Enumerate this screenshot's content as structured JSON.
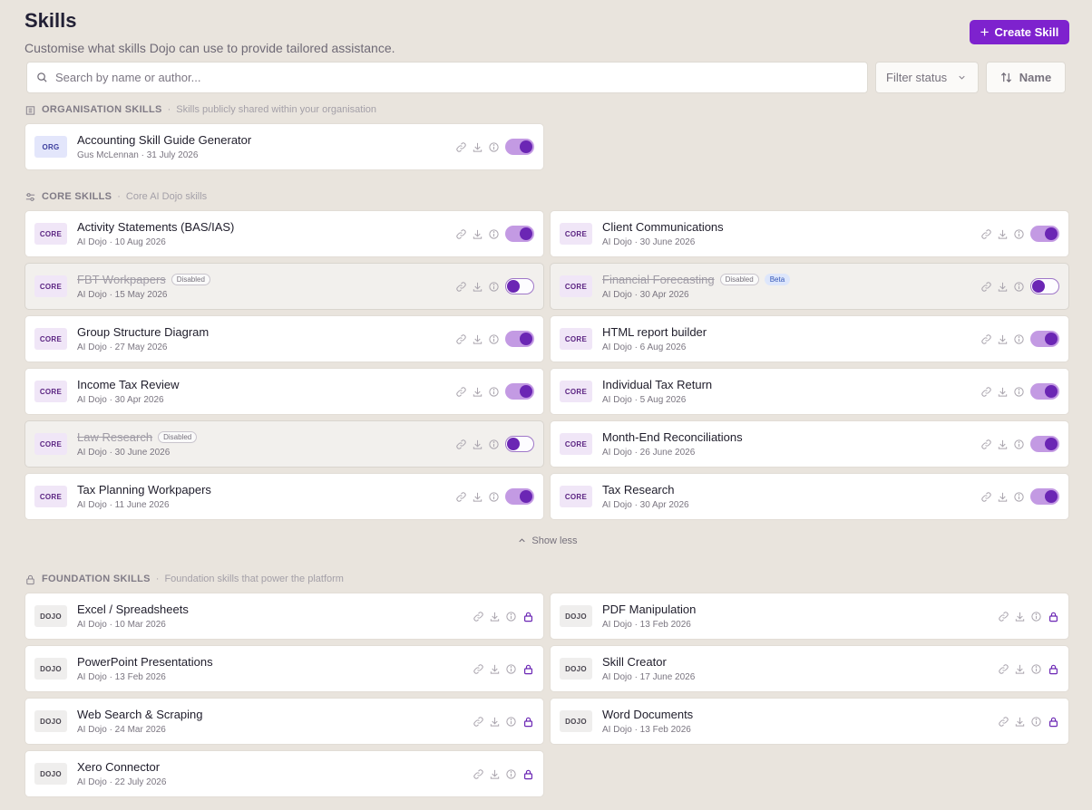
{
  "header": {
    "title": "Skills",
    "subtitle": "Customise what skills Dojo can use to provide tailored assistance.",
    "create_button": "Create Skill"
  },
  "toolbar": {
    "search_placeholder": "Search by name or author...",
    "filter_label": "Filter status",
    "sort_label": "Name"
  },
  "sections": {
    "org": {
      "title": "ORGANISATION SKILLS",
      "description": "Skills publicly shared within your organisation"
    },
    "core": {
      "title": "CORE SKILLS",
      "description": "Core AI Dojo skills"
    },
    "foundation": {
      "title": "FOUNDATION SKILLS",
      "description": "Foundation skills that power the platform"
    }
  },
  "show_less": "Show less",
  "badges": {
    "org": "ORG",
    "core": "CORE",
    "dojo": "DOJO"
  },
  "tags": {
    "disabled": "Disabled",
    "beta": "Beta"
  },
  "org_skills": [
    {
      "name": "Accounting Skill Guide Generator",
      "meta": "Gus McLennan · 31 July 2026",
      "enabled": true
    }
  ],
  "core_skills": [
    {
      "name": "Activity Statements (BAS/IAS)",
      "meta": "AI Dojo · 10 Aug 2026",
      "enabled": true
    },
    {
      "name": "Client Communications",
      "meta": "AI Dojo · 30 June 2026",
      "enabled": true
    },
    {
      "name": "FBT Workpapers",
      "meta": "AI Dojo · 15 May 2026",
      "enabled": false
    },
    {
      "name": "Financial Forecasting",
      "meta": "AI Dojo · 30 Apr 2026",
      "enabled": false,
      "beta": true
    },
    {
      "name": "Group Structure Diagram",
      "meta": "AI Dojo · 27 May 2026",
      "enabled": true
    },
    {
      "name": "HTML report builder",
      "meta": "AI Dojo · 6 Aug 2026",
      "enabled": true
    },
    {
      "name": "Income Tax Review",
      "meta": "AI Dojo · 30 Apr 2026",
      "enabled": true
    },
    {
      "name": "Individual Tax Return",
      "meta": "AI Dojo · 5 Aug 2026",
      "enabled": true
    },
    {
      "name": "Law Research",
      "meta": "AI Dojo · 30 June 2026",
      "enabled": false
    },
    {
      "name": "Month-End Reconciliations",
      "meta": "AI Dojo · 26 June 2026",
      "enabled": true
    },
    {
      "name": "Tax Planning Workpapers",
      "meta": "AI Dojo · 11 June 2026",
      "enabled": true
    },
    {
      "name": "Tax Research",
      "meta": "AI Dojo · 30 Apr 2026",
      "enabled": true
    }
  ],
  "foundation_skills": [
    {
      "name": "Excel / Spreadsheets",
      "meta": "AI Dojo · 10 Mar 2026"
    },
    {
      "name": "PDF Manipulation",
      "meta": "AI Dojo · 13 Feb 2026"
    },
    {
      "name": "PowerPoint Presentations",
      "meta": "AI Dojo · 13 Feb 2026"
    },
    {
      "name": "Skill Creator",
      "meta": "AI Dojo · 17 June 2026"
    },
    {
      "name": "Web Search & Scraping",
      "meta": "AI Dojo · 24 Mar 2026"
    },
    {
      "name": "Word Documents",
      "meta": "AI Dojo · 13 Feb 2026"
    },
    {
      "name": "Xero Connector",
      "meta": "AI Dojo · 22 July 2026"
    }
  ],
  "colors": {
    "accent": "#7e22ce",
    "toggle_on_track": "#c39ae3",
    "toggle_knob": "#6b26b4",
    "background": "#e9e4dd"
  }
}
